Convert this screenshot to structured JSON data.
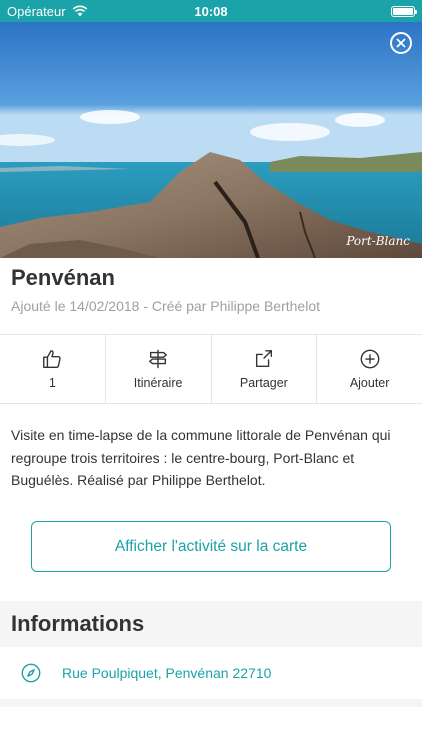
{
  "status_bar": {
    "carrier": "Opérateur",
    "time": "10:08",
    "wifi_icon": "wifi-icon",
    "battery_icon": "battery-icon",
    "color": "#1aa3a9"
  },
  "hero": {
    "watermark": "Port-Blanc",
    "close_icon": "close-icon"
  },
  "activity": {
    "title": "Penvénan",
    "added": "Ajouté le 14/02/2018",
    "separator": " - ",
    "creator": "Créé par Philippe Berthelot"
  },
  "actions": [
    {
      "icon": "thumbs-up-icon",
      "label": "1"
    },
    {
      "icon": "signpost-icon",
      "label": "Itinéraire"
    },
    {
      "icon": "share-icon",
      "label": "Partager"
    },
    {
      "icon": "plus-circle-icon",
      "label": "Ajouter"
    }
  ],
  "description": "Visite en time-lapse de la commune littorale de Penvénan qui regroupe trois territoires : le centre-bourg, Port-Blanc et Buguélès. Réalisé par Philippe Berthelot.",
  "map_button": {
    "label": "Afficher l'activité sur la carte"
  },
  "informations": {
    "title": "Informations",
    "address_icon": "compass-icon",
    "address": "Rue Poulpiquet, Penvénan 22710"
  },
  "colors": {
    "accent": "#1aa3a9",
    "text": "#333333",
    "muted": "#a0a0a0"
  }
}
